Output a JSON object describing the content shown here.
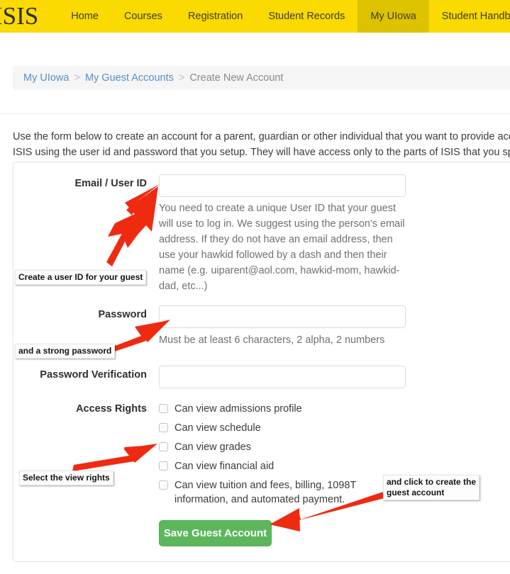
{
  "nav": {
    "brand": "ISIS",
    "items": [
      {
        "label": "Home",
        "active": false
      },
      {
        "label": "Courses",
        "active": false
      },
      {
        "label": "Registration",
        "active": false
      },
      {
        "label": "Student Records",
        "active": false
      },
      {
        "label": "My UIowa",
        "active": true
      },
      {
        "label": "Student Handbook",
        "active": false
      }
    ],
    "bar_color": "#fada00",
    "active_color": "#ddc200"
  },
  "breadcrumb": {
    "item1": "My UIowa",
    "sep1": ">",
    "item2": "My Guest Accounts",
    "sep2": ">",
    "current": "Create New Account"
  },
  "intro": {
    "line1": "Use the form below to create an account for a parent, guardian or other individual that you want to provide acc",
    "line2": "ISIS using the user id and password that you setup. They will have access only to the parts of ISIS that you spe"
  },
  "form": {
    "email": {
      "label": "Email / User ID",
      "value": "",
      "placeholder": "",
      "help": "You need to create a unique User ID that your guest will use to log in. We suggest using the person's email address. If they do not have an email address, then use your hawkid followed by a dash and then their name (e.g. uiparent@aol.com, hawkid-mom, hawkid-dad, etc...)"
    },
    "password": {
      "label": "Password",
      "value": "",
      "placeholder": "",
      "help": "Must be at least 6 characters, 2 alpha, 2 numbers"
    },
    "password_verification": {
      "label": "Password Verification",
      "value": "",
      "placeholder": ""
    },
    "access_rights": {
      "label": "Access Rights",
      "options": [
        {
          "label": "Can view admissions profile",
          "checked": false
        },
        {
          "label": "Can view schedule",
          "checked": false
        },
        {
          "label": "Can view grades",
          "checked": false
        },
        {
          "label": "Can view financial aid",
          "checked": false
        },
        {
          "label": "Can view tuition and fees, billing, 1098T information, and automated payment.",
          "checked": false
        }
      ]
    },
    "save_button": {
      "label": "Save Guest Account",
      "color": "#5cb75c"
    }
  },
  "annotations": {
    "arrow_color": "#ee2b11",
    "userid": "Create a user ID for your guest",
    "password": "and a strong password",
    "rights": "Select the view rights",
    "save": "and click to create the\nguest account"
  }
}
